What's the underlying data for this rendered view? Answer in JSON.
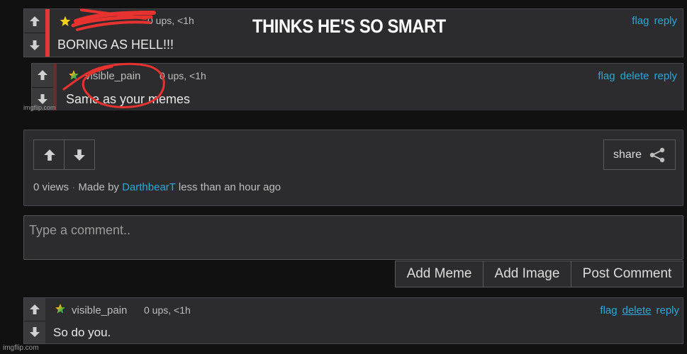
{
  "overlay_text": "THINKS HE'S SO SMART",
  "watermark": "imgflip.com",
  "comment1": {
    "meta": "0 ups, <1h",
    "text": "BORING AS HELL!!!",
    "actions": [
      "flag",
      "reply"
    ]
  },
  "comment2": {
    "username": "visible_pain",
    "meta": "0 ups, <1h",
    "text": "Same as your memes",
    "actions": [
      "flag",
      "delete",
      "reply"
    ]
  },
  "meme_panel": {
    "share_label": "share",
    "views": "0 views",
    "made_by": "Made by",
    "author": "DarthbearT",
    "time": "less than an hour ago"
  },
  "comment_form": {
    "placeholder": "Type a comment..",
    "add_meme": "Add Meme",
    "add_image": "Add Image",
    "post_comment": "Post Comment"
  },
  "comment3": {
    "username": "visible_pain",
    "meta": "0 ups, <1h",
    "text": "So do you.",
    "actions": [
      "flag",
      "delete",
      "reply"
    ]
  },
  "colors": {
    "link": "#2aa8d8",
    "accent_red": "#e23a3a",
    "scribble_red": "#e8322f"
  }
}
